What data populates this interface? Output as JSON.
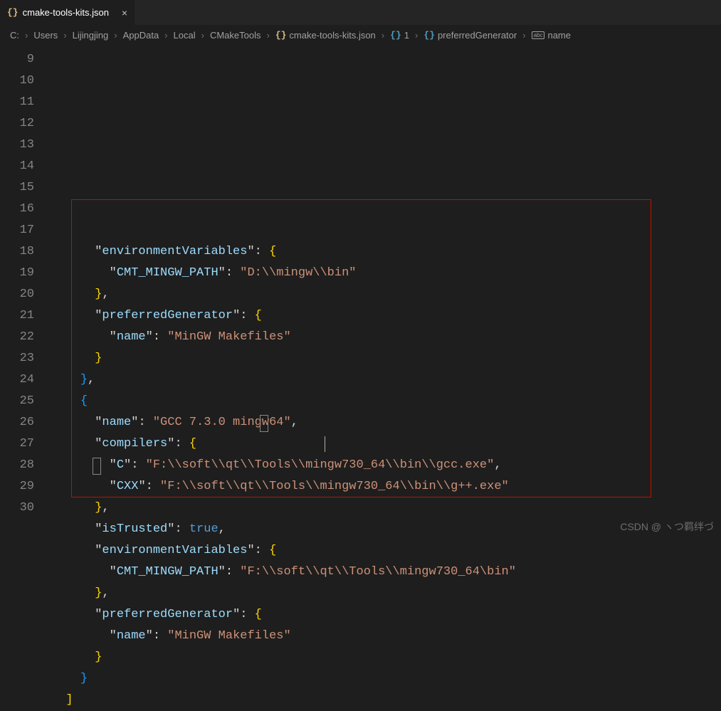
{
  "tab": {
    "icon": "{}",
    "filename": "cmake-tools-kits.json",
    "close": "×"
  },
  "breadcrumb": {
    "parts": [
      "C:",
      "Users",
      "Lijingjing",
      "AppData",
      "Local",
      "CMakeTools"
    ],
    "file_icon": "{}",
    "file": "cmake-tools-kits.json",
    "sym1_icon": "{}",
    "sym1": "1",
    "sym2_icon": "{}",
    "sym2": "preferredGenerator",
    "sym3_icon": "abc",
    "sym3": "name",
    "sep": "›"
  },
  "gutter": {
    "start": 9,
    "end": 30
  },
  "code": {
    "l9": {
      "indent": "      ",
      "key": "environmentVariables",
      "after": ": {"
    },
    "l10": {
      "indent": "        ",
      "key": "CMT_MINGW_PATH",
      "val": "D:\\\\mingw\\\\bin"
    },
    "l11": {
      "indent": "      ",
      "text": "},"
    },
    "l12": {
      "indent": "      ",
      "key": "preferredGenerator",
      "after": ": {"
    },
    "l13": {
      "indent": "        ",
      "key": "name",
      "val": "MinGW Makefiles"
    },
    "l14": {
      "indent": "      ",
      "text": "}"
    },
    "l15": {
      "indent": "    ",
      "text": "},"
    },
    "l16": {
      "indent": "    ",
      "text": "{"
    },
    "l17": {
      "indent": "      ",
      "key": "name",
      "val": "GCC 7.3.0 mingw64",
      "comma": ","
    },
    "l18": {
      "indent": "      ",
      "key": "compilers",
      "after": ": {"
    },
    "l19": {
      "indent": "        ",
      "key": "C",
      "val": "F:\\\\soft\\\\qt\\\\Tools\\\\mingw730_64\\\\bin\\\\gcc.exe",
      "comma": ","
    },
    "l20": {
      "indent": "        ",
      "key": "CXX",
      "val": "F:\\\\soft\\\\qt\\\\Tools\\\\mingw730_64\\\\bin\\\\g++.exe"
    },
    "l21": {
      "indent": "      ",
      "text": "},"
    },
    "l22": {
      "indent": "      ",
      "key": "isTrusted",
      "bool": "true",
      "comma": ","
    },
    "l23": {
      "indent": "      ",
      "key": "environmentVariables",
      "after": ": {"
    },
    "l24": {
      "indent": "        ",
      "key": "CMT_MINGW_PATH",
      "val": "F:\\\\soft\\\\qt\\\\Tools\\\\mingw730_64\\bin"
    },
    "l25": {
      "indent": "      ",
      "text": "},"
    },
    "l26": {
      "indent": "      ",
      "key": "preferredGenerator",
      "after": ": {"
    },
    "l27": {
      "indent": "        ",
      "key": "name",
      "val": "MinGW Makefiles"
    },
    "l28": {
      "indent": "      ",
      "text": "}"
    },
    "l29": {
      "indent": "    ",
      "text": "}"
    },
    "l30": {
      "indent": "  ",
      "text": "]"
    }
  },
  "watermark": "CSDN @ ヽつ羁绊づ"
}
